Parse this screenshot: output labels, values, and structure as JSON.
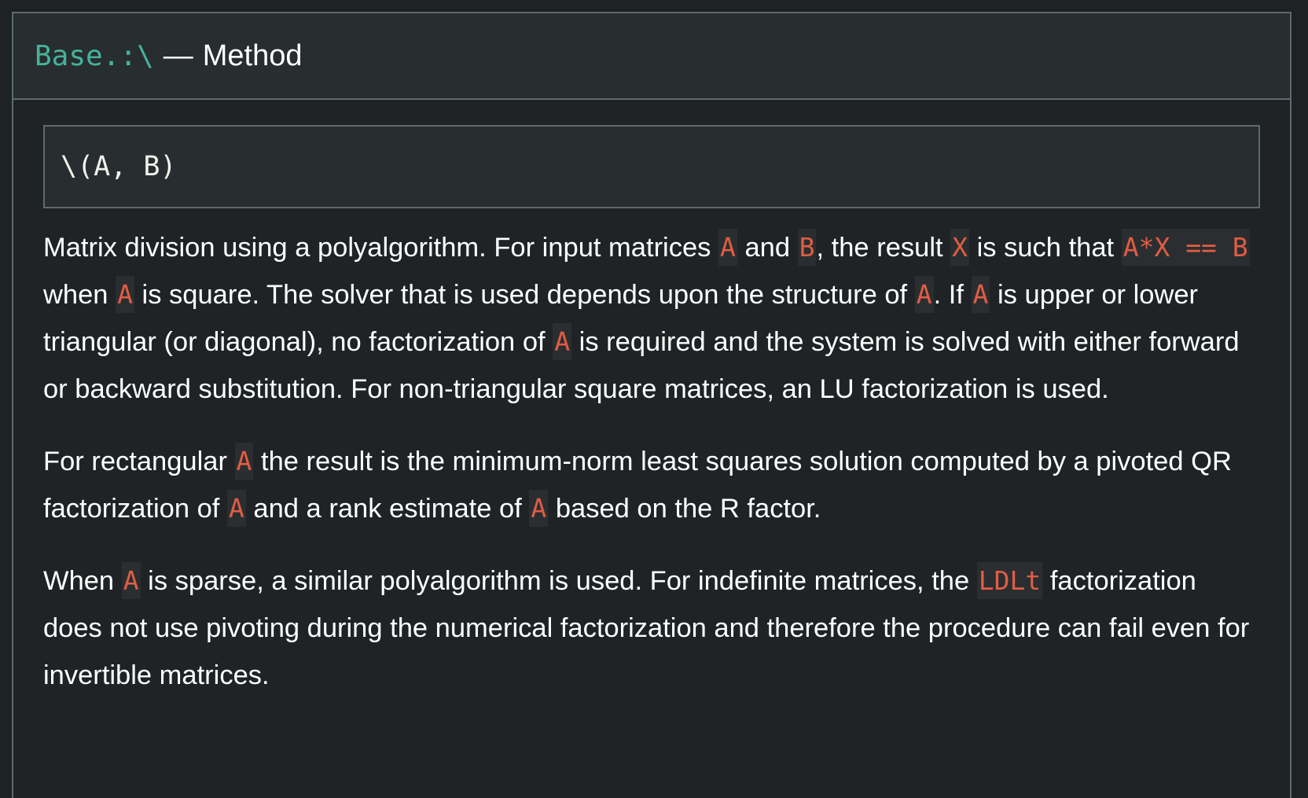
{
  "header": {
    "name": "Base.:\\",
    "separator": "—",
    "category": "Method"
  },
  "signature": "\\(A, B)",
  "paragraphs": [
    [
      {
        "t": "Matrix division using a polyalgorithm. For input matrices "
      },
      {
        "t": "A",
        "code": true
      },
      {
        "t": " and "
      },
      {
        "t": "B",
        "code": true
      },
      {
        "t": ", the result "
      },
      {
        "t": "X",
        "code": true
      },
      {
        "t": " is such that "
      },
      {
        "t": "A*X == B",
        "code": true
      },
      {
        "t": " when "
      },
      {
        "t": "A",
        "code": true
      },
      {
        "t": " is square. The solver that is used depends upon the structure of "
      },
      {
        "t": "A",
        "code": true
      },
      {
        "t": ". If "
      },
      {
        "t": "A",
        "code": true
      },
      {
        "t": " is upper or lower triangular (or diagonal), no factorization of "
      },
      {
        "t": "A",
        "code": true
      },
      {
        "t": " is required and the system is solved with either forward or backward substitution. For non-triangular square matrices, an LU factorization is used."
      }
    ],
    [
      {
        "t": "For rectangular "
      },
      {
        "t": "A",
        "code": true
      },
      {
        "t": " the result is the minimum-norm least squares solution computed by a pivoted QR factorization of "
      },
      {
        "t": "A",
        "code": true
      },
      {
        "t": " and a rank estimate of "
      },
      {
        "t": "A",
        "code": true
      },
      {
        "t": " based on the R factor."
      }
    ],
    [
      {
        "t": "When "
      },
      {
        "t": "A",
        "code": true
      },
      {
        "t": " is sparse, a similar polyalgorithm is used. For indefinite matrices, the "
      },
      {
        "t": "LDLt",
        "code": true
      },
      {
        "t": " factorization does not use pivoting during the numerical factorization and therefore the procedure can fail even for invertible matrices."
      }
    ]
  ]
}
